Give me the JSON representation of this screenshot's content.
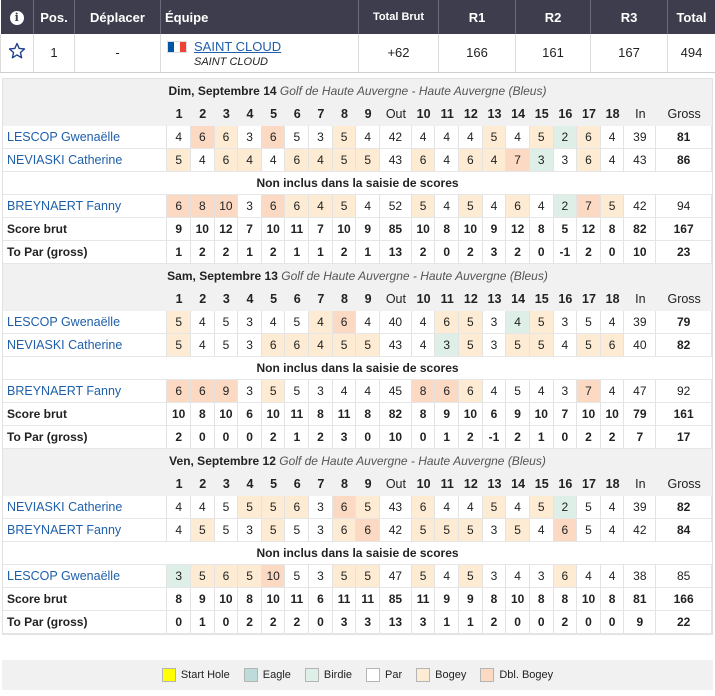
{
  "header": {
    "info_icon": "i",
    "pos_label": "Pos.",
    "move_label": "Déplacer",
    "team_label": "Équipe",
    "total_brut_label": "Total Brut",
    "r1_label": "R1",
    "r2_label": "R2",
    "r3_label": "R3",
    "total_label": "Total"
  },
  "team_row": {
    "favorite_icon": "star-outline-icon",
    "position": "1",
    "move": "-",
    "team_name": "SAINT CLOUD",
    "team_club": "SAINT CLOUD",
    "flag_colors": [
      "#0055a4",
      "#ffffff",
      "#ef4135"
    ],
    "total_brut": "+62",
    "r1": "166",
    "r2": "161",
    "r3": "167",
    "total": "494"
  },
  "colors": {
    "start_hole": "#ffff00",
    "eagle": "#bddbd8",
    "birdie": "#ddefe6",
    "par": "#ffffff",
    "bogey": "#fdecd3",
    "dbl_bogey": "#fbd9c3"
  },
  "hole_headers": [
    "1",
    "2",
    "3",
    "4",
    "5",
    "6",
    "7",
    "8",
    "9",
    "Out",
    "10",
    "11",
    "12",
    "13",
    "14",
    "15",
    "16",
    "17",
    "18",
    "In",
    "Gross"
  ],
  "rounds": [
    {
      "date": "Dim, Septembre 14",
      "course": "Golf de Haute Auvergne - Haute Auvergne (Bleus)",
      "rows": [
        {
          "type": "player",
          "name": "LESCOP Gwenaëlle",
          "bold_gross": true,
          "scores": [
            "4",
            "6",
            "6",
            "3",
            "6",
            "5",
            "3",
            "5",
            "4",
            "42",
            "4",
            "4",
            "4",
            "5",
            "4",
            "5",
            "2",
            "6",
            "4",
            "39",
            "81"
          ],
          "cls": [
            "",
            "dbl",
            "bogey",
            "",
            "dbl",
            "",
            "",
            "bogey",
            "",
            "",
            "",
            "",
            "",
            "bogey",
            "",
            "bogey",
            "birdie",
            "bogey",
            "",
            "",
            ""
          ]
        },
        {
          "type": "player",
          "name": "NEVIASKI Catherine",
          "bold_gross": true,
          "scores": [
            "5",
            "4",
            "6",
            "4",
            "4",
            "6",
            "4",
            "5",
            "5",
            "43",
            "6",
            "4",
            "6",
            "4",
            "7",
            "3",
            "3",
            "6",
            "4",
            "43",
            "86"
          ],
          "cls": [
            "bogey",
            "",
            "bogey",
            "bogey",
            "",
            "bogey",
            "bogey",
            "bogey",
            "bogey",
            "",
            "bogey",
            "",
            "bogey",
            "bogey",
            "dbl",
            "birdie",
            "",
            "bogey",
            "",
            "",
            ""
          ]
        },
        {
          "type": "note",
          "text": "Non inclus dans la saisie de scores"
        },
        {
          "type": "player",
          "name": "BREYNAERT Fanny",
          "bold_gross": false,
          "scores": [
            "6",
            "8",
            "10",
            "3",
            "6",
            "6",
            "4",
            "5",
            "4",
            "52",
            "5",
            "4",
            "5",
            "4",
            "6",
            "4",
            "2",
            "7",
            "5",
            "42",
            "94"
          ],
          "cls": [
            "dbl",
            "dbl",
            "dbl",
            "",
            "dbl",
            "bogey",
            "bogey",
            "bogey",
            "",
            "",
            "bogey",
            "",
            "bogey",
            "",
            "bogey",
            "",
            "birdie",
            "dbl",
            "bogey",
            "",
            ""
          ]
        },
        {
          "type": "sum",
          "name": "Score brut",
          "scores": [
            "9",
            "10",
            "12",
            "7",
            "10",
            "11",
            "7",
            "10",
            "9",
            "85",
            "10",
            "8",
            "10",
            "9",
            "12",
            "8",
            "5",
            "12",
            "8",
            "82",
            "167"
          ]
        },
        {
          "type": "sum",
          "name": "To Par (gross)",
          "scores": [
            "1",
            "2",
            "2",
            "1",
            "2",
            "1",
            "1",
            "2",
            "1",
            "13",
            "2",
            "0",
            "2",
            "3",
            "2",
            "0",
            "-1",
            "2",
            "0",
            "10",
            "23"
          ]
        }
      ]
    },
    {
      "date": "Sam, Septembre 13",
      "course": "Golf de Haute Auvergne - Haute Auvergne (Bleus)",
      "rows": [
        {
          "type": "player",
          "name": "LESCOP Gwenaëlle",
          "bold_gross": true,
          "scores": [
            "5",
            "4",
            "5",
            "3",
            "4",
            "5",
            "4",
            "6",
            "4",
            "40",
            "4",
            "6",
            "5",
            "3",
            "4",
            "5",
            "3",
            "5",
            "4",
            "39",
            "79"
          ],
          "cls": [
            "bogey",
            "",
            "",
            "",
            "",
            "",
            "bogey",
            "dbl",
            "",
            "",
            "",
            "bogey",
            "bogey",
            "",
            "birdie",
            "bogey",
            "",
            "",
            "",
            " ",
            ""
          ]
        },
        {
          "type": "player",
          "name": "NEVIASKI Catherine",
          "bold_gross": true,
          "scores": [
            "5",
            "4",
            "5",
            "3",
            "6",
            "6",
            "4",
            "5",
            "5",
            "43",
            "4",
            "3",
            "5",
            "3",
            "5",
            "5",
            "4",
            "5",
            "6",
            "40",
            "82"
          ],
          "cls": [
            "bogey",
            "",
            "",
            "",
            "bogey",
            "bogey",
            "bogey",
            "bogey",
            "bogey",
            "",
            "",
            "birdie",
            "bogey",
            "",
            "bogey",
            "bogey",
            "",
            "bogey",
            "bogey",
            "",
            ""
          ]
        },
        {
          "type": "note",
          "text": "Non inclus dans la saisie de scores"
        },
        {
          "type": "player",
          "name": "BREYNAERT Fanny",
          "bold_gross": false,
          "scores": [
            "6",
            "6",
            "9",
            "3",
            "5",
            "5",
            "3",
            "4",
            "4",
            "45",
            "8",
            "6",
            "6",
            "4",
            "5",
            "4",
            "3",
            "7",
            "4",
            "47",
            "92"
          ],
          "cls": [
            "dbl",
            "dbl",
            "dbl",
            "",
            "bogey",
            "",
            "",
            "",
            "",
            "",
            "dbl",
            "dbl",
            "bogey",
            "",
            "",
            "",
            "",
            "dbl",
            "",
            "",
            ""
          ]
        },
        {
          "type": "sum",
          "name": "Score brut",
          "scores": [
            "10",
            "8",
            "10",
            "6",
            "10",
            "11",
            "8",
            "11",
            "8",
            "82",
            "8",
            "9",
            "10",
            "6",
            "9",
            "10",
            "7",
            "10",
            "10",
            "79",
            "161"
          ]
        },
        {
          "type": "sum",
          "name": "To Par (gross)",
          "scores": [
            "2",
            "0",
            "0",
            "0",
            "2",
            "1",
            "2",
            "3",
            "0",
            "10",
            "0",
            "1",
            "2",
            "-1",
            "2",
            "1",
            "0",
            "2",
            "2",
            "7",
            "17"
          ]
        }
      ]
    },
    {
      "date": "Ven, Septembre 12",
      "course": "Golf de Haute Auvergne - Haute Auvergne (Bleus)",
      "rows": [
        {
          "type": "player",
          "name": "NEVIASKI Catherine",
          "bold_gross": true,
          "scores": [
            "4",
            "4",
            "5",
            "5",
            "5",
            "6",
            "3",
            "6",
            "5",
            "43",
            "6",
            "4",
            "4",
            "5",
            "4",
            "5",
            "2",
            "5",
            "4",
            "39",
            "82"
          ],
          "cls": [
            "",
            "",
            "",
            "bogey",
            "bogey",
            "bogey",
            "",
            "dbl",
            "bogey",
            "",
            "bogey",
            "",
            "",
            "bogey",
            "",
            "bogey",
            "birdie",
            "",
            "",
            "",
            ""
          ]
        },
        {
          "type": "player",
          "name": "BREYNAERT Fanny",
          "bold_gross": true,
          "scores": [
            "4",
            "5",
            "5",
            "3",
            "5",
            "5",
            "3",
            "6",
            "6",
            "42",
            "5",
            "5",
            "5",
            "3",
            "5",
            "4",
            "6",
            "5",
            "4",
            "42",
            "84"
          ],
          "cls": [
            "",
            "bogey",
            "",
            "",
            "bogey",
            "",
            "",
            "bogey",
            "dbl",
            "",
            "bogey",
            "bogey",
            "bogey",
            "",
            "bogey",
            "",
            "dbl",
            "",
            "",
            "",
            ""
          ]
        },
        {
          "type": "note",
          "text": "Non inclus dans la saisie de scores"
        },
        {
          "type": "player",
          "name": "LESCOP Gwenaëlle",
          "bold_gross": false,
          "scores": [
            "3",
            "5",
            "6",
            "5",
            "10",
            "5",
            "3",
            "5",
            "5",
            "47",
            "5",
            "4",
            "5",
            "3",
            "4",
            "3",
            "6",
            "4",
            "4",
            "38",
            "85"
          ],
          "cls": [
            "birdie",
            "bogey",
            "bogey",
            "bogey",
            "dbl",
            "",
            "",
            "bogey",
            "bogey",
            "",
            "bogey",
            "",
            "bogey",
            "",
            "",
            "",
            "bogey",
            "",
            "",
            "",
            ""
          ]
        },
        {
          "type": "sum",
          "name": "Score brut",
          "scores": [
            "8",
            "9",
            "10",
            "8",
            "10",
            "11",
            "6",
            "11",
            "11",
            "85",
            "11",
            "9",
            "9",
            "8",
            "10",
            "8",
            "8",
            "10",
            "8",
            "81",
            "166"
          ]
        },
        {
          "type": "sum",
          "name": "To Par (gross)",
          "scores": [
            "0",
            "1",
            "0",
            "2",
            "2",
            "2",
            "0",
            "3",
            "3",
            "13",
            "3",
            "1",
            "1",
            "2",
            "0",
            "0",
            "2",
            "0",
            "0",
            "9",
            "22"
          ]
        }
      ]
    }
  ],
  "legend": [
    {
      "label": "Start Hole",
      "color": "#ffff00"
    },
    {
      "label": "Eagle",
      "color": "#bddbd8"
    },
    {
      "label": "Birdie",
      "color": "#ddefe6"
    },
    {
      "label": "Par",
      "color": "#ffffff"
    },
    {
      "label": "Bogey",
      "color": "#fdecd3"
    },
    {
      "label": "Dbl. Bogey",
      "color": "#fbd9c3"
    }
  ]
}
